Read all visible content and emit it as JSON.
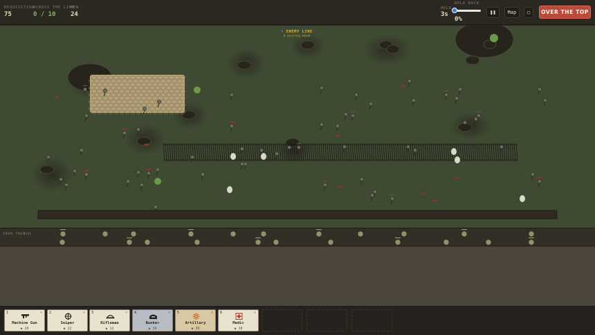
{
  "hud": {
    "requisition_label": "REQUISITION",
    "requisition_value": "75",
    "across_label": "ACROSS THE LINE",
    "across_value": "0 / 10",
    "men_label": "MEN",
    "men_value": "24",
    "held_label": "HELD",
    "held_value": "3s",
    "hold_back_label": "HOLD BACK",
    "hold_back_value": "0%",
    "hold_back_fraction": 0.0,
    "pause_label": "❚❚",
    "map_label": "Map",
    "square_label": "▢",
    "over_the_top_label": "OVER THE TOP"
  },
  "field": {
    "enemy_line_label": "⚡ ENEMY LINE",
    "enemy_line_sub": "0 securing ahead",
    "your_trench_label": "YOUR TRENCH"
  },
  "cards": [
    {
      "key": "1",
      "name": "Machine Gun",
      "cost": "◆ 20",
      "icon": "machine-gun-icon"
    },
    {
      "key": "2",
      "name": "Sniper",
      "cost": "◆ 22",
      "icon": "crosshair-icon"
    },
    {
      "key": "3",
      "name": "Rifleman",
      "cost": "◆ 12",
      "icon": "helmet-icon"
    },
    {
      "key": "4",
      "name": "Bunker",
      "cost": "◆ 34",
      "icon": "bunker-icon"
    },
    {
      "key": "5",
      "name": "Artillery",
      "cost": "◆ 30",
      "icon": "explosion-icon"
    },
    {
      "key": "6",
      "name": "Medic",
      "cost": "◆ 18",
      "icon": "medic-cross-icon"
    }
  ],
  "colors": {
    "field": "#3e4a32",
    "over_the_top": "#b94a3c",
    "enemy_unit": "#9c3a2c",
    "friendly_unit": "#8f9468"
  }
}
